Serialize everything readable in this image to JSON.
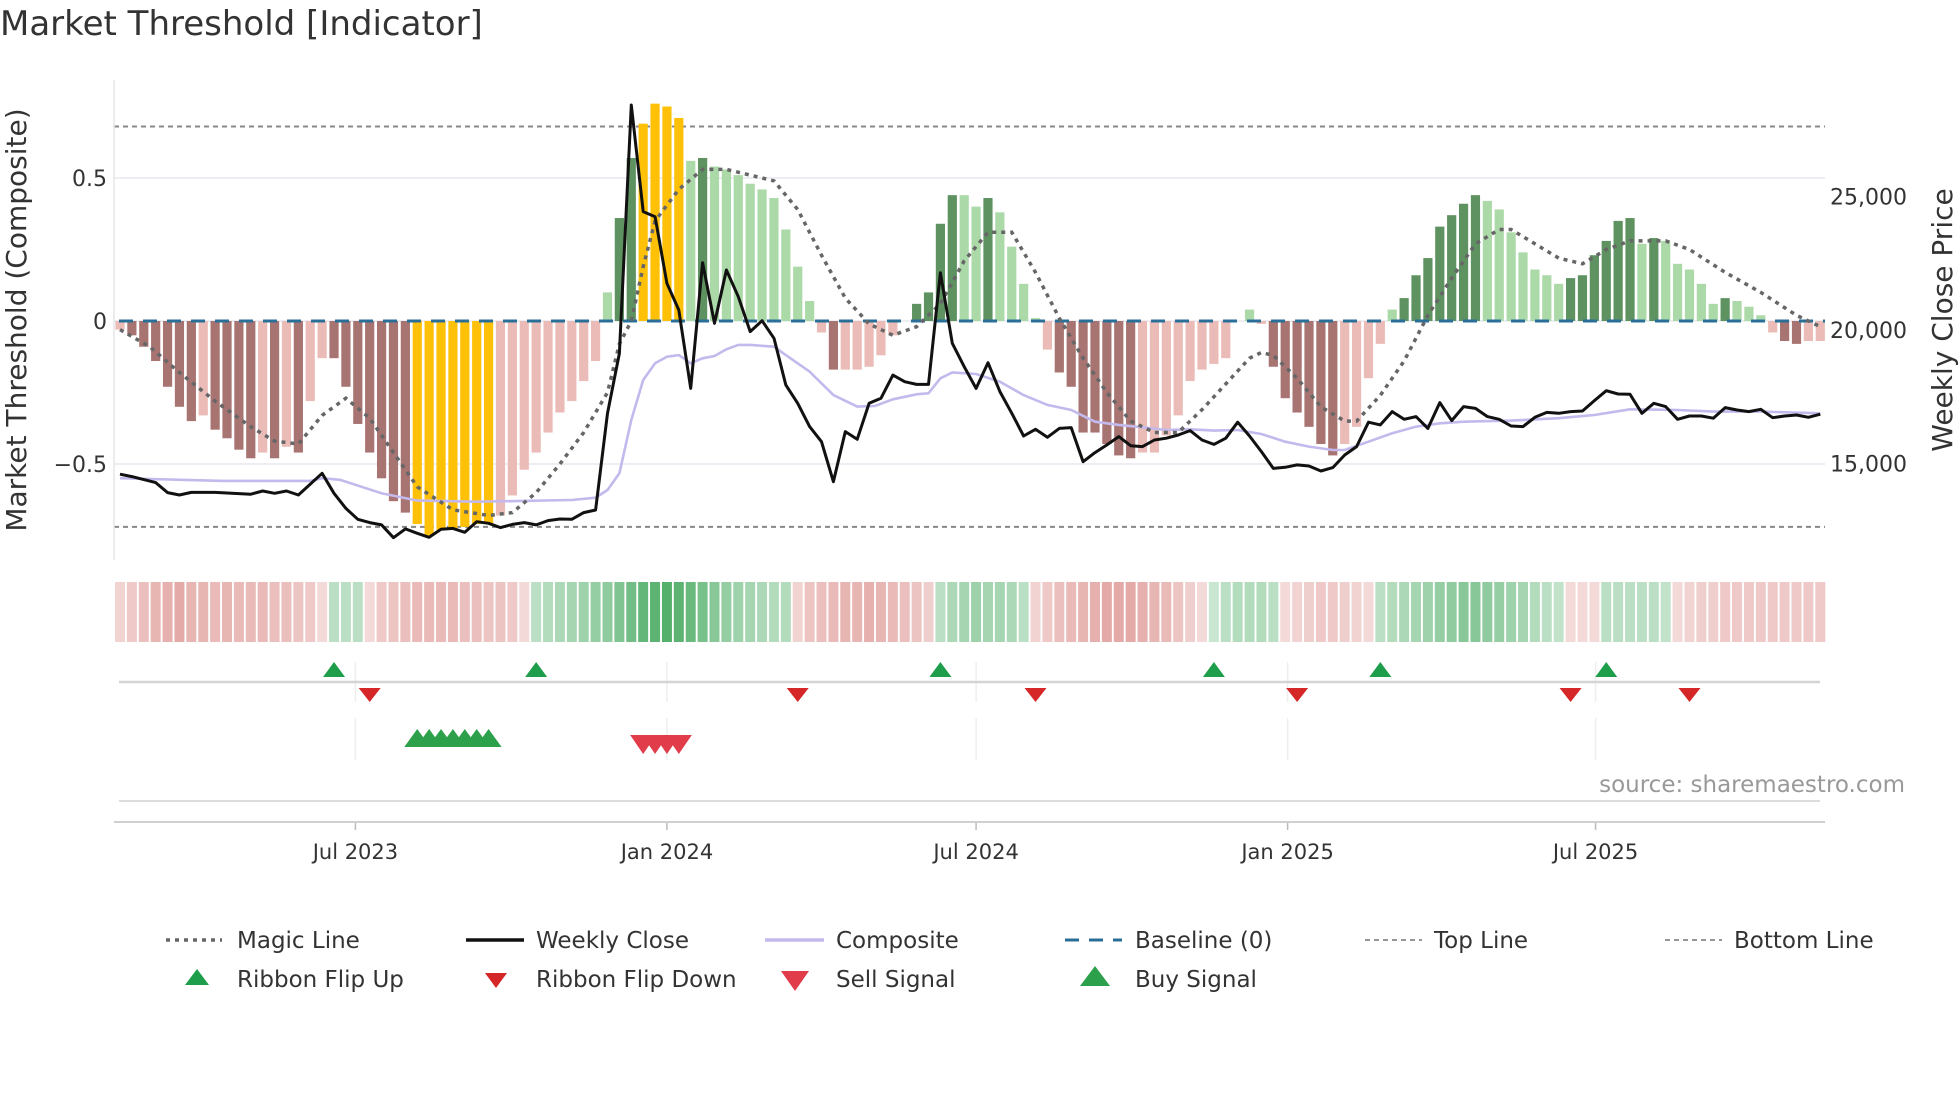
{
  "title": "Market Threshold [Indicator]",
  "source": "source: sharemaestro.com",
  "legend": {
    "magic_line": "Magic Line",
    "weekly_close": "Weekly Close",
    "composite": "Composite",
    "baseline": "Baseline (0)",
    "top_line": "Top Line",
    "bottom_line": "Bottom Line",
    "flip_up": "Ribbon Flip Up",
    "flip_down": "Ribbon Flip Down",
    "sell": "Sell Signal",
    "buy": "Buy Signal"
  },
  "colors": {
    "dark_red": "#a87472",
    "light_red": "#ebbcb7",
    "yellow": "#ffc107",
    "dark_green": "#5e9260",
    "light_green": "#acd9a8",
    "magic": "#666666",
    "close": "#111111",
    "composite": "#c3b9ec",
    "baseline": "#2a6f97",
    "flip_up": "#1e9e4a",
    "flip_down": "#d62728",
    "buy": "#2ca04a",
    "sell": "#e03c4a",
    "ribbon_red": "#cf6b66",
    "ribbon_green": "#2e9e4a"
  },
  "chart_data": {
    "type": "bar+line",
    "title": "Market Threshold [Indicator]",
    "ylabel": "Market Threshold (Composite)",
    "ylabel_right": "Weekly Close Price",
    "ylim": [
      -0.82,
      0.78
    ],
    "ylim_right": [
      12100,
      28500
    ],
    "yticks": [
      {
        "v": 0.5,
        "label": "0.5"
      },
      {
        "v": 0,
        "label": "0"
      },
      {
        "v": -0.5,
        "label": "−0.5"
      }
    ],
    "yticks_right": [
      {
        "v": 25000,
        "label": "25,000"
      },
      {
        "v": 20000,
        "label": "20,000"
      },
      {
        "v": 15000,
        "label": "15,000"
      }
    ],
    "xticks": [
      {
        "week": 20.8,
        "label": "Jul 2023"
      },
      {
        "week": 47.0,
        "label": "Jan 2024"
      },
      {
        "week": 73.0,
        "label": "Jul 2024"
      },
      {
        "week": 99.2,
        "label": "Jan 2025"
      },
      {
        "week": 125.1,
        "label": "Jul 2025"
      }
    ],
    "weeks": 144,
    "top_line": 0.68,
    "bottom_line": -0.72,
    "baseline": 0,
    "histogram": [
      -0.03,
      -0.05,
      -0.09,
      -0.14,
      -0.23,
      -0.3,
      -0.35,
      -0.33,
      -0.38,
      -0.41,
      -0.45,
      -0.48,
      -0.46,
      -0.48,
      -0.44,
      -0.46,
      -0.28,
      -0.13,
      -0.13,
      -0.23,
      -0.36,
      -0.46,
      -0.55,
      -0.63,
      -0.67,
      -0.71,
      -0.75,
      -0.73,
      -0.73,
      -0.72,
      -0.71,
      -0.71,
      -0.68,
      -0.61,
      -0.52,
      -0.46,
      -0.39,
      -0.32,
      -0.28,
      -0.21,
      -0.14,
      0.1,
      0.36,
      0.57,
      0.69,
      0.76,
      0.75,
      0.71,
      0.56,
      0.57,
      0.54,
      0.53,
      0.51,
      0.48,
      0.46,
      0.43,
      0.32,
      0.19,
      0.07,
      -0.04,
      -0.17,
      -0.17,
      -0.17,
      -0.16,
      -0.12,
      -0.05,
      0,
      0.06,
      0.1,
      0.34,
      0.44,
      0.44,
      0.4,
      0.43,
      0.38,
      0.26,
      0.13,
      0.01,
      -0.1,
      -0.18,
      -0.23,
      -0.39,
      -0.39,
      -0.43,
      -0.47,
      -0.48,
      -0.46,
      -0.46,
      -0.4,
      -0.33,
      -0.21,
      -0.17,
      -0.15,
      -0.13,
      0,
      0.04,
      -0.01,
      -0.16,
      -0.27,
      -0.32,
      -0.37,
      -0.43,
      -0.47,
      -0.43,
      -0.37,
      -0.2,
      -0.08,
      0.04,
      0.08,
      0.16,
      0.22,
      0.33,
      0.37,
      0.41,
      0.44,
      0.42,
      0.39,
      0.31,
      0.24,
      0.18,
      0.16,
      0.13,
      0.15,
      0.16,
      0.23,
      0.28,
      0.35,
      0.36,
      0.27,
      0.29,
      0.28,
      0.2,
      0.18,
      0.13,
      0.06,
      0.08,
      0.07,
      0.05,
      0.02,
      -0.04,
      -0.07,
      -0.08,
      -0.07,
      -0.07
    ],
    "histogram_class": [
      "lr",
      "dr",
      "dr",
      "dr",
      "dr",
      "dr",
      "dr",
      "lr",
      "dr",
      "dr",
      "dr",
      "dr",
      "lr",
      "dr",
      "lr",
      "dr",
      "lr",
      "lr",
      "dr",
      "dr",
      "dr",
      "dr",
      "dr",
      "dr",
      "dr",
      "y",
      "y",
      "y",
      "y",
      "y",
      "y",
      "y",
      "lr",
      "lr",
      "lr",
      "lr",
      "lr",
      "lr",
      "lr",
      "lr",
      "lr",
      "lg",
      "dg",
      "dg",
      "y",
      "y",
      "y",
      "y",
      "lg",
      "dg",
      "lg",
      "lg",
      "lg",
      "lg",
      "lg",
      "lg",
      "lg",
      "lg",
      "lg",
      "lr",
      "dr",
      "lr",
      "lr",
      "lr",
      "lr",
      "lr",
      "lr",
      "dg",
      "dg",
      "dg",
      "dg",
      "lg",
      "lg",
      "dg",
      "lg",
      "lg",
      "lg",
      "lg",
      "lr",
      "dr",
      "dr",
      "dr",
      "dr",
      "dr",
      "dr",
      "dr",
      "lr",
      "lr",
      "lr",
      "lr",
      "lr",
      "lr",
      "lr",
      "lr",
      "lg",
      "lg",
      "lr",
      "dr",
      "dr",
      "dr",
      "dr",
      "dr",
      "dr",
      "lr",
      "lr",
      "lr",
      "lr",
      "lg",
      "dg",
      "dg",
      "dg",
      "dg",
      "dg",
      "dg",
      "dg",
      "lg",
      "lg",
      "lg",
      "lg",
      "lg",
      "lg",
      "lg",
      "dg",
      "dg",
      "dg",
      "dg",
      "dg",
      "dg",
      "lg",
      "dg",
      "lg",
      "lg",
      "lg",
      "lg",
      "lg",
      "dg",
      "lg",
      "lg",
      "lg",
      "lr",
      "dr",
      "dr",
      "lr",
      "lr"
    ],
    "magic_line": [
      [
        1,
        -0.03
      ],
      [
        3.5,
        -0.09
      ],
      [
        6,
        -0.18
      ],
      [
        9,
        -0.28
      ],
      [
        12,
        -0.37
      ],
      [
        14,
        -0.42
      ],
      [
        16,
        -0.43
      ],
      [
        18,
        -0.33
      ],
      [
        20,
        -0.27
      ],
      [
        22,
        -0.34
      ],
      [
        24,
        -0.46
      ],
      [
        26,
        -0.58
      ],
      [
        29,
        -0.66
      ],
      [
        32,
        -0.68
      ],
      [
        34,
        -0.67
      ],
      [
        36,
        -0.6
      ],
      [
        38,
        -0.5
      ],
      [
        40,
        -0.39
      ],
      [
        42,
        -0.25
      ],
      [
        43,
        -0.08
      ],
      [
        44,
        0
      ],
      [
        45,
        0.19
      ],
      [
        46,
        0.35
      ],
      [
        48,
        0.46
      ],
      [
        50,
        0.53
      ],
      [
        52,
        0.53
      ],
      [
        54,
        0.51
      ],
      [
        56,
        0.49
      ],
      [
        58,
        0.39
      ],
      [
        60,
        0.23
      ],
      [
        62,
        0.08
      ],
      [
        64,
        -0.01
      ],
      [
        66,
        -0.05
      ],
      [
        68,
        -0.02
      ],
      [
        70,
        0.06
      ],
      [
        72,
        0.21
      ],
      [
        74,
        0.31
      ],
      [
        76,
        0.31
      ],
      [
        78,
        0.17
      ],
      [
        80,
        0.01
      ],
      [
        82,
        -0.13
      ],
      [
        84,
        -0.25
      ],
      [
        86,
        -0.35
      ],
      [
        88,
        -0.39
      ],
      [
        90,
        -0.39
      ],
      [
        92,
        -0.31
      ],
      [
        94,
        -0.22
      ],
      [
        96,
        -0.13
      ],
      [
        97,
        -0.11
      ],
      [
        98,
        -0.12
      ],
      [
        100,
        -0.2
      ],
      [
        102,
        -0.3
      ],
      [
        104,
        -0.35
      ],
      [
        105,
        -0.35
      ],
      [
        107,
        -0.26
      ],
      [
        109,
        -0.14
      ],
      [
        111,
        0.02
      ],
      [
        113,
        0.15
      ],
      [
        115,
        0.27
      ],
      [
        117,
        0.32
      ],
      [
        118,
        0.32
      ],
      [
        120,
        0.27
      ],
      [
        122,
        0.22
      ],
      [
        124,
        0.2
      ],
      [
        126,
        0.25
      ],
      [
        128,
        0.28
      ],
      [
        131,
        0.28
      ],
      [
        133,
        0.25
      ],
      [
        136,
        0.17
      ],
      [
        139,
        0.1
      ],
      [
        142,
        0.02
      ],
      [
        144,
        -0.02
      ]
    ],
    "weekly_close": [
      [
        1,
        14590
      ],
      [
        2,
        14500
      ],
      [
        4,
        14275
      ],
      [
        5,
        13900
      ],
      [
        6,
        13810
      ],
      [
        7,
        13910
      ],
      [
        9,
        13910
      ],
      [
        12,
        13840
      ],
      [
        13,
        13960
      ],
      [
        14,
        13875
      ],
      [
        15,
        13960
      ],
      [
        16,
        13810
      ],
      [
        18,
        14625
      ],
      [
        19,
        13875
      ],
      [
        20,
        13310
      ],
      [
        21,
        12900
      ],
      [
        22,
        12775
      ],
      [
        23,
        12690
      ],
      [
        24,
        12210
      ],
      [
        25,
        12540
      ],
      [
        26,
        12375
      ],
      [
        27,
        12225
      ],
      [
        28,
        12525
      ],
      [
        29,
        12560
      ],
      [
        30,
        12410
      ],
      [
        31,
        12810
      ],
      [
        32,
        12750
      ],
      [
        33,
        12590
      ],
      [
        34,
        12710
      ],
      [
        35,
        12775
      ],
      [
        36,
        12690
      ],
      [
        37,
        12850
      ],
      [
        38,
        12910
      ],
      [
        39,
        12900
      ],
      [
        40,
        13150
      ],
      [
        41,
        13250
      ],
      [
        42,
        16875
      ],
      [
        43,
        19125
      ],
      [
        44,
        28440
      ],
      [
        45,
        24440
      ],
      [
        46,
        24250
      ],
      [
        47,
        21750
      ],
      [
        48,
        20750
      ],
      [
        49,
        17810
      ],
      [
        50,
        22525
      ],
      [
        51,
        20250
      ],
      [
        52,
        22250
      ],
      [
        53,
        21250
      ],
      [
        54,
        19940
      ],
      [
        55,
        20350
      ],
      [
        56,
        19690
      ],
      [
        57,
        17940
      ],
      [
        58,
        17250
      ],
      [
        59,
        16375
      ],
      [
        60,
        15810
      ],
      [
        61,
        14310
      ],
      [
        62,
        16190
      ],
      [
        63,
        15900
      ],
      [
        64,
        17250
      ],
      [
        65,
        17440
      ],
      [
        66,
        18310
      ],
      [
        67,
        18060
      ],
      [
        68,
        17960
      ],
      [
        69,
        17960
      ],
      [
        70,
        22150
      ],
      [
        71,
        19500
      ],
      [
        72,
        18625
      ],
      [
        73,
        17810
      ],
      [
        74,
        18775
      ],
      [
        75,
        17690
      ],
      [
        76,
        16875
      ],
      [
        77,
        16025
      ],
      [
        78,
        16275
      ],
      [
        79,
        15975
      ],
      [
        80,
        16310
      ],
      [
        81,
        16340
      ],
      [
        82,
        15060
      ],
      [
        83,
        15400
      ],
      [
        84,
        15690
      ],
      [
        85,
        16000
      ],
      [
        86,
        15660
      ],
      [
        87,
        15625
      ],
      [
        88,
        15875
      ],
      [
        89,
        15940
      ],
      [
        90,
        16060
      ],
      [
        91,
        16225
      ],
      [
        92,
        15875
      ],
      [
        93,
        15710
      ],
      [
        94,
        15940
      ],
      [
        95,
        16540
      ],
      [
        96,
        16025
      ],
      [
        97,
        15440
      ],
      [
        98,
        14810
      ],
      [
        99,
        14850
      ],
      [
        100,
        14940
      ],
      [
        101,
        14900
      ],
      [
        102,
        14710
      ],
      [
        103,
        14840
      ],
      [
        104,
        15310
      ],
      [
        105,
        15625
      ],
      [
        106,
        16540
      ],
      [
        107,
        16440
      ],
      [
        108,
        16940
      ],
      [
        109,
        16650
      ],
      [
        110,
        16750
      ],
      [
        111,
        16310
      ],
      [
        112,
        17275
      ],
      [
        113,
        16600
      ],
      [
        114,
        17125
      ],
      [
        115,
        17060
      ],
      [
        116,
        16750
      ],
      [
        117,
        16650
      ],
      [
        118,
        16400
      ],
      [
        119,
        16375
      ],
      [
        120,
        16725
      ],
      [
        121,
        16910
      ],
      [
        122,
        16875
      ],
      [
        123,
        16940
      ],
      [
        124,
        16960
      ],
      [
        125,
        17350
      ],
      [
        126,
        17725
      ],
      [
        127,
        17600
      ],
      [
        128,
        17590
      ],
      [
        129,
        16875
      ],
      [
        130,
        17250
      ],
      [
        131,
        17125
      ],
      [
        132,
        16650
      ],
      [
        133,
        16775
      ],
      [
        134,
        16775
      ],
      [
        135,
        16690
      ],
      [
        136,
        17090
      ],
      [
        137,
        17000
      ],
      [
        138,
        16940
      ],
      [
        139,
        17025
      ],
      [
        140,
        16710
      ],
      [
        141,
        16775
      ],
      [
        142,
        16810
      ],
      [
        143,
        16725
      ],
      [
        144,
        16840
      ]
    ],
    "composite": [
      [
        1,
        14440
      ],
      [
        9.7,
        14340
      ],
      [
        17,
        14340
      ],
      [
        18,
        14440
      ],
      [
        19.5,
        14380
      ],
      [
        23,
        13875
      ],
      [
        26,
        13600
      ],
      [
        31,
        13560
      ],
      [
        39,
        13625
      ],
      [
        41,
        13710
      ],
      [
        42,
        14000
      ],
      [
        43,
        14625
      ],
      [
        44,
        16625
      ],
      [
        45,
        18125
      ],
      [
        46,
        18750
      ],
      [
        47,
        19000
      ],
      [
        48,
        19060
      ],
      [
        49,
        18750
      ],
      [
        50,
        18940
      ],
      [
        51,
        19025
      ],
      [
        52,
        19275
      ],
      [
        53,
        19440
      ],
      [
        54,
        19440
      ],
      [
        56,
        19375
      ],
      [
        57,
        19060
      ],
      [
        59,
        18440
      ],
      [
        61,
        17560
      ],
      [
        63,
        17125
      ],
      [
        64.5,
        17150
      ],
      [
        66,
        17400
      ],
      [
        68,
        17590
      ],
      [
        69,
        17625
      ],
      [
        70,
        18190
      ],
      [
        71,
        18410
      ],
      [
        73,
        18350
      ],
      [
        75,
        18060
      ],
      [
        77,
        17560
      ],
      [
        79,
        17190
      ],
      [
        81,
        17000
      ],
      [
        83,
        16560
      ],
      [
        85,
        16440
      ],
      [
        87,
        16350
      ],
      [
        89,
        16250
      ],
      [
        91,
        16275
      ],
      [
        93,
        16225
      ],
      [
        95,
        16250
      ],
      [
        97,
        16100
      ],
      [
        99,
        15810
      ],
      [
        101,
        15625
      ],
      [
        103,
        15500
      ],
      [
        104,
        15500
      ],
      [
        106,
        15810
      ],
      [
        108,
        16125
      ],
      [
        110,
        16375
      ],
      [
        112,
        16500
      ],
      [
        114,
        16560
      ],
      [
        118,
        16600
      ],
      [
        122,
        16690
      ],
      [
        125,
        16810
      ],
      [
        128,
        17025
      ],
      [
        132,
        17000
      ],
      [
        135,
        16940
      ],
      [
        139,
        16940
      ],
      [
        144,
        16875
      ]
    ],
    "ribbon": [
      -0.2,
      -0.3,
      -0.4,
      -0.5,
      -0.55,
      -0.6,
      -0.5,
      -0.5,
      -0.45,
      -0.5,
      -0.45,
      -0.45,
      -0.45,
      -0.4,
      -0.4,
      -0.35,
      -0.3,
      -0.15,
      0.25,
      0.25,
      0.25,
      -0.15,
      -0.3,
      -0.35,
      -0.4,
      -0.45,
      -0.45,
      -0.45,
      -0.45,
      -0.4,
      -0.4,
      -0.35,
      -0.35,
      -0.3,
      -0.15,
      0.25,
      0.3,
      0.35,
      0.4,
      0.45,
      0.5,
      0.55,
      0.65,
      0.75,
      0.85,
      0.9,
      0.95,
      0.9,
      0.8,
      0.7,
      0.6,
      0.5,
      0.45,
      0.4,
      0.35,
      0.3,
      0.3,
      -0.2,
      -0.35,
      -0.4,
      -0.45,
      -0.5,
      -0.5,
      -0.55,
      -0.5,
      -0.45,
      -0.4,
      -0.35,
      -0.25,
      0.25,
      0.35,
      0.4,
      0.45,
      0.4,
      0.4,
      0.35,
      0.25,
      -0.2,
      -0.3,
      -0.4,
      -0.45,
      -0.5,
      -0.55,
      -0.6,
      -0.6,
      -0.6,
      -0.55,
      -0.5,
      -0.45,
      -0.35,
      -0.25,
      -0.15,
      0.15,
      0.25,
      0.3,
      0.3,
      0.3,
      0.25,
      -0.15,
      -0.2,
      -0.25,
      -0.3,
      -0.3,
      -0.25,
      -0.2,
      -0.15,
      0.25,
      0.3,
      0.35,
      0.4,
      0.45,
      0.5,
      0.55,
      0.6,
      0.6,
      0.55,
      0.5,
      0.45,
      0.4,
      0.3,
      0.25,
      0.2,
      -0.15,
      -0.15,
      -0.15,
      0.25,
      0.25,
      0.25,
      0.25,
      0.25,
      0.2,
      -0.15,
      -0.2,
      -0.25,
      -0.25,
      -0.3,
      -0.3,
      -0.3,
      -0.3,
      -0.3,
      -0.3,
      -0.3,
      -0.3,
      -0.3
    ],
    "flip_up_weeks": [
      19,
      36,
      70,
      93,
      107,
      126
    ],
    "flip_down_weeks": [
      22,
      58,
      78,
      100,
      123,
      133
    ],
    "buy_signal_weeks": [
      26,
      27,
      28,
      29,
      30,
      31,
      32
    ],
    "sell_signal_weeks": [
      45,
      46,
      47,
      48
    ],
    "legend_position": "bottom"
  }
}
